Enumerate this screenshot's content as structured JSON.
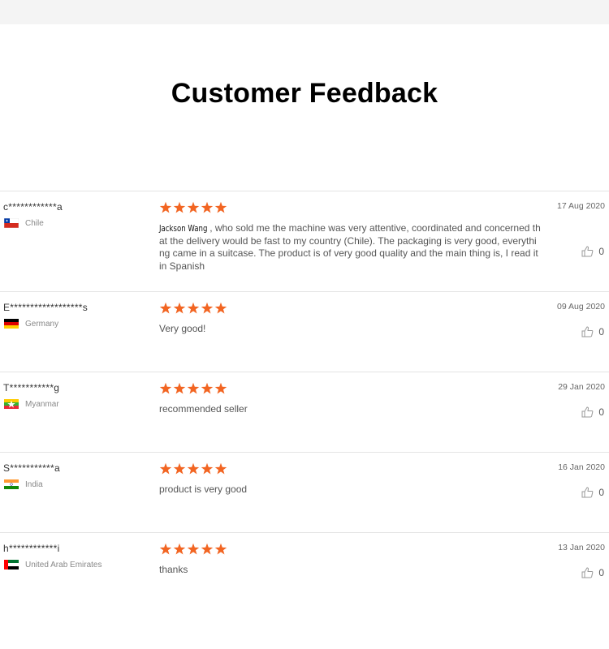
{
  "page": {
    "title": "Customer Feedback"
  },
  "colors": {
    "star": "#f26522",
    "flag_chile_red": "#d52b1e",
    "flag_chile_blue": "#0039a6"
  },
  "reviews": [
    {
      "user": "c************a",
      "country": "Chile",
      "flag_icon": "chile-flag-icon",
      "rating": 5,
      "date": "17 Aug 2020",
      "signature": "Jackson Wang",
      "text": ", who sold me the machine was very attentive, coordinated and concerned that the delivery would be fast to my country (Chile).  The packaging is very good, everything came in a suitcase.  The product is of very good quality and the main thing is, I read it in Spanish",
      "likes": "0"
    },
    {
      "user": "E******************s",
      "country": "Germany",
      "flag_icon": "germany-flag-icon",
      "rating": 5,
      "date": "09 Aug 2020",
      "text": "Very good!",
      "likes": "0"
    },
    {
      "user": "T***********g",
      "country": "Myanmar",
      "flag_icon": "myanmar-flag-icon",
      "rating": 5,
      "date": "29 Jan 2020",
      "text": "recommended seller",
      "likes": "0"
    },
    {
      "user": "S***********a",
      "country": "India",
      "flag_icon": "india-flag-icon",
      "rating": 5,
      "date": "16 Jan 2020",
      "text": "product is very good",
      "likes": "0"
    },
    {
      "user": "h************i",
      "country": "United Arab Emirates",
      "flag_icon": "uae-flag-icon",
      "rating": 5,
      "date": "13 Jan 2020",
      "text": "thanks",
      "likes": "0"
    }
  ]
}
